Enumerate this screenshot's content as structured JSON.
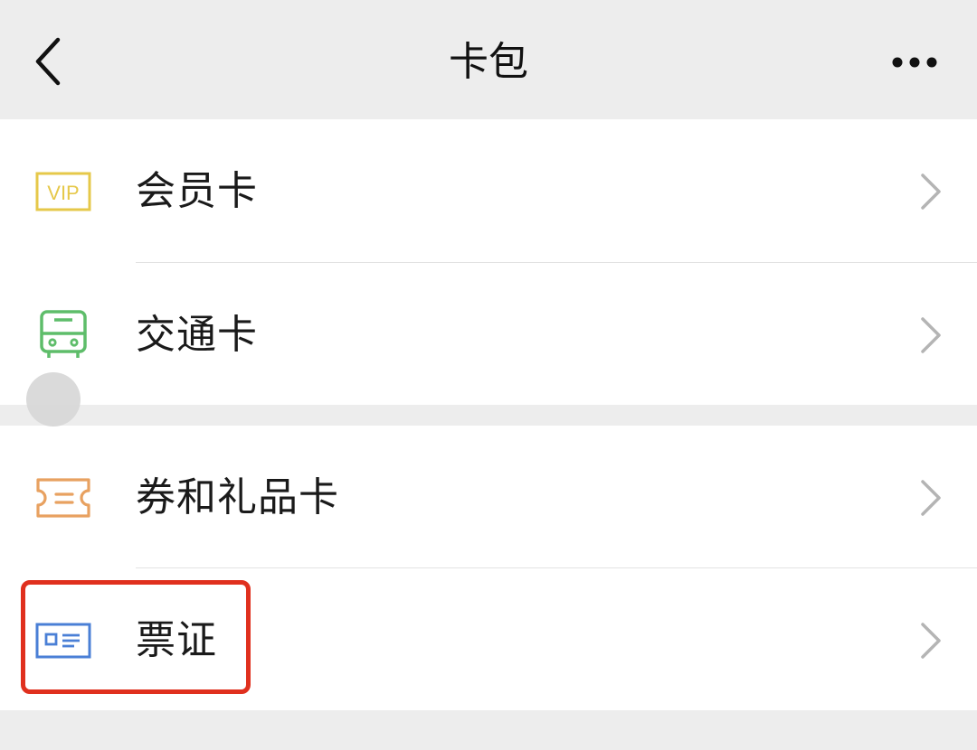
{
  "header": {
    "title": "卡包",
    "back_icon": "chevron-left-icon",
    "more_icon": "more-dots-icon"
  },
  "cards": {
    "items": [
      {
        "label": "会员卡",
        "icon": "vip-card-icon",
        "icon_color": "#e6c84a"
      },
      {
        "label": "交通卡",
        "icon": "bus-icon",
        "icon_color": "#5ebd6a"
      },
      {
        "label": "券和礼品卡",
        "icon": "ticket-icon",
        "icon_color": "#e8a160"
      },
      {
        "label": "票证",
        "icon": "id-card-icon",
        "icon_color": "#4a7fd6"
      }
    ],
    "vip_icon_text": "VIP"
  },
  "annotation": {
    "highlight_color": "#e0301e"
  }
}
